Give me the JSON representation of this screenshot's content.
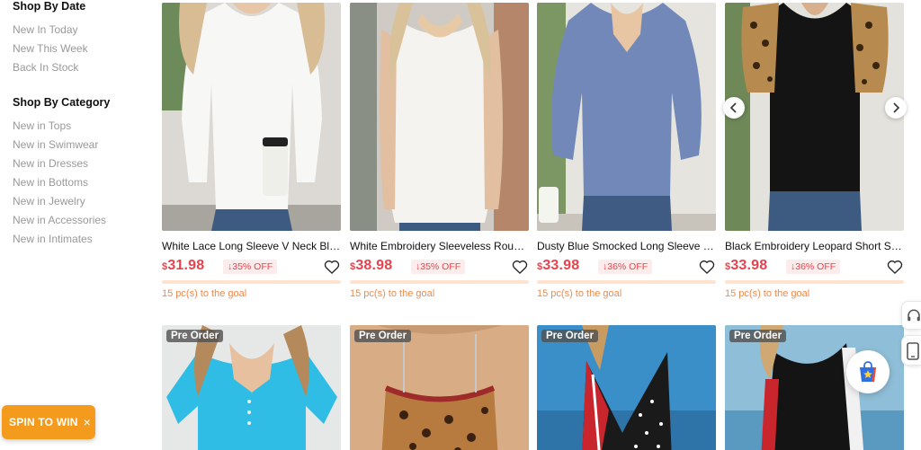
{
  "sidebar": {
    "date_title": "Shop By Date",
    "date_links": [
      "New In Today",
      "New This Week",
      "Back In Stock"
    ],
    "category_title": "Shop By Category",
    "category_links": [
      "New in Tops",
      "New in Swimwear",
      "New in Dresses",
      "New in Bottoms",
      "New in Jewelry",
      "New in Accessories",
      "New in Intimates"
    ]
  },
  "products_row1": [
    {
      "title": "White Lace Long Sleeve V Neck Blouse",
      "currency": "$",
      "price": "31.98",
      "discount": "35% OFF",
      "goal": "15 pc(s) to the goal",
      "progress": 0.0
    },
    {
      "title": "White Embroidery Sleeveless Round Neck Blouse",
      "currency": "$",
      "price": "38.98",
      "discount": "35% OFF",
      "goal": "15 pc(s) to the goal",
      "progress": 0.0
    },
    {
      "title": "Dusty Blue Smocked Long Sleeve Shirt",
      "currency": "$",
      "price": "33.98",
      "discount": "36% OFF",
      "goal": "15 pc(s) to the goal",
      "progress": 0.0
    },
    {
      "title": "Black Embroidery Leopard Short Sleeve Blouse",
      "currency": "$",
      "price": "33.98",
      "discount": "36% OFF",
      "goal": "15 pc(s) to the goal",
      "progress": 0.0
    }
  ],
  "products_row2": [
    {
      "badge": "Pre Order"
    },
    {
      "badge": "Pre Order"
    },
    {
      "badge": "Pre Order"
    },
    {
      "badge": "Pre Order"
    }
  ],
  "widgets": {
    "spin_label": "SPIN TO WIN",
    "spin_close": "×"
  },
  "colors": {
    "price": "#e7434e",
    "discount_bg": "#fdecec",
    "goal_text": "#f0894a",
    "progress_track": "#fde3d0",
    "spin_bg": "#f49a1c"
  },
  "icons": [
    "heart-icon",
    "chevron-left-icon",
    "chevron-right-icon",
    "headset-icon",
    "mobile-icon",
    "shopping-bag-star-icon",
    "close-icon",
    "discount-arrow-icon"
  ]
}
